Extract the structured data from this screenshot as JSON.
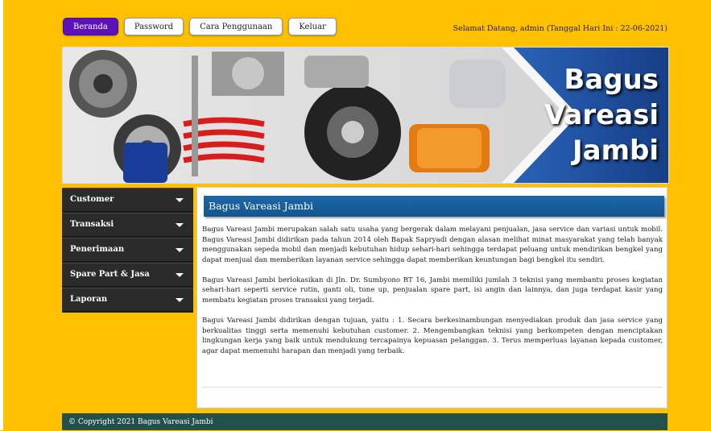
{
  "nav": {
    "items": [
      {
        "label": "Beranda",
        "active": true
      },
      {
        "label": "Password",
        "active": false
      },
      {
        "label": "Cara Penggunaan",
        "active": false
      },
      {
        "label": "Keluar",
        "active": false
      }
    ],
    "welcome": "Selamat Datang, admin (Tanggal Hari Ini : 22-06-2021)"
  },
  "banner": {
    "line1": "Bagus",
    "line2": "Vareasi",
    "line3": "Jambi"
  },
  "sidebar": {
    "items": [
      {
        "label": "Customer"
      },
      {
        "label": "Transaksi"
      },
      {
        "label": "Penerimaan"
      },
      {
        "label": "Spare Part & Jasa"
      },
      {
        "label": "Laporan"
      }
    ]
  },
  "main": {
    "title": "Bagus Vareasi Jambi",
    "paragraphs": [
      "Bagus Vareasi Jambi merupakan salah satu usaha yang bergerak dalam melayani penjualan, jasa service dan variasi untuk mobil. Bagus Vareasi Jambi didirikan pada tahun 2014 oleh Bapak Sapryadi dengan alasan melihat minat masyarakat yang telah banyak menggunakan sepeda mobil dan menjadi kebutuhan hidup sehari-hari sehingga terdapat peluang untuk mendirikan bengkel yang dapat menjual dan memberikan layanan service sehingga dapat memberikan keuntungan bagi bengkel itu sendiri.",
      "Bagus Vareasi Jambi berlokasikan di Jln. Dr. Sumbyono RT 16, Jambi memiliki jumlah 3 teknisi yang membantu proses kegiatan sehari-hari seperti service rutin, ganti oli, tune up, penjualan spare part, isi angin dan lainnya, dan juga terdapat kasir yang membatu kegiatan proses transaksi yang terjadi.",
      "Bagus Vareasi Jambi didirikan dengan tujuan, yaitu : 1. Secara berkesinambungan menyediakan produk dan jasa service yang berkualitas tinggi serta memenuhi kebutuhan customer. 2. Mengembangkan teknisi yang berkompeten dengan menciptakan lingkungan kerja yang baik untuk mendukung tercapainya kepuasan pelanggan. 3. Terus memperluas layanan kepada customer, agar dapat memenuhi harapan dan menjadi yang terbaik."
    ]
  },
  "footer": {
    "text": "© Copyright 2021 Bagus Vareasi Jambi"
  },
  "colors": {
    "page_bg": "#ffc000",
    "nav_active": "#5b12b8",
    "sidebar_bg": "#2b2b2b",
    "header_blue": "#1c66a8",
    "footer_bg": "#234f4d"
  }
}
